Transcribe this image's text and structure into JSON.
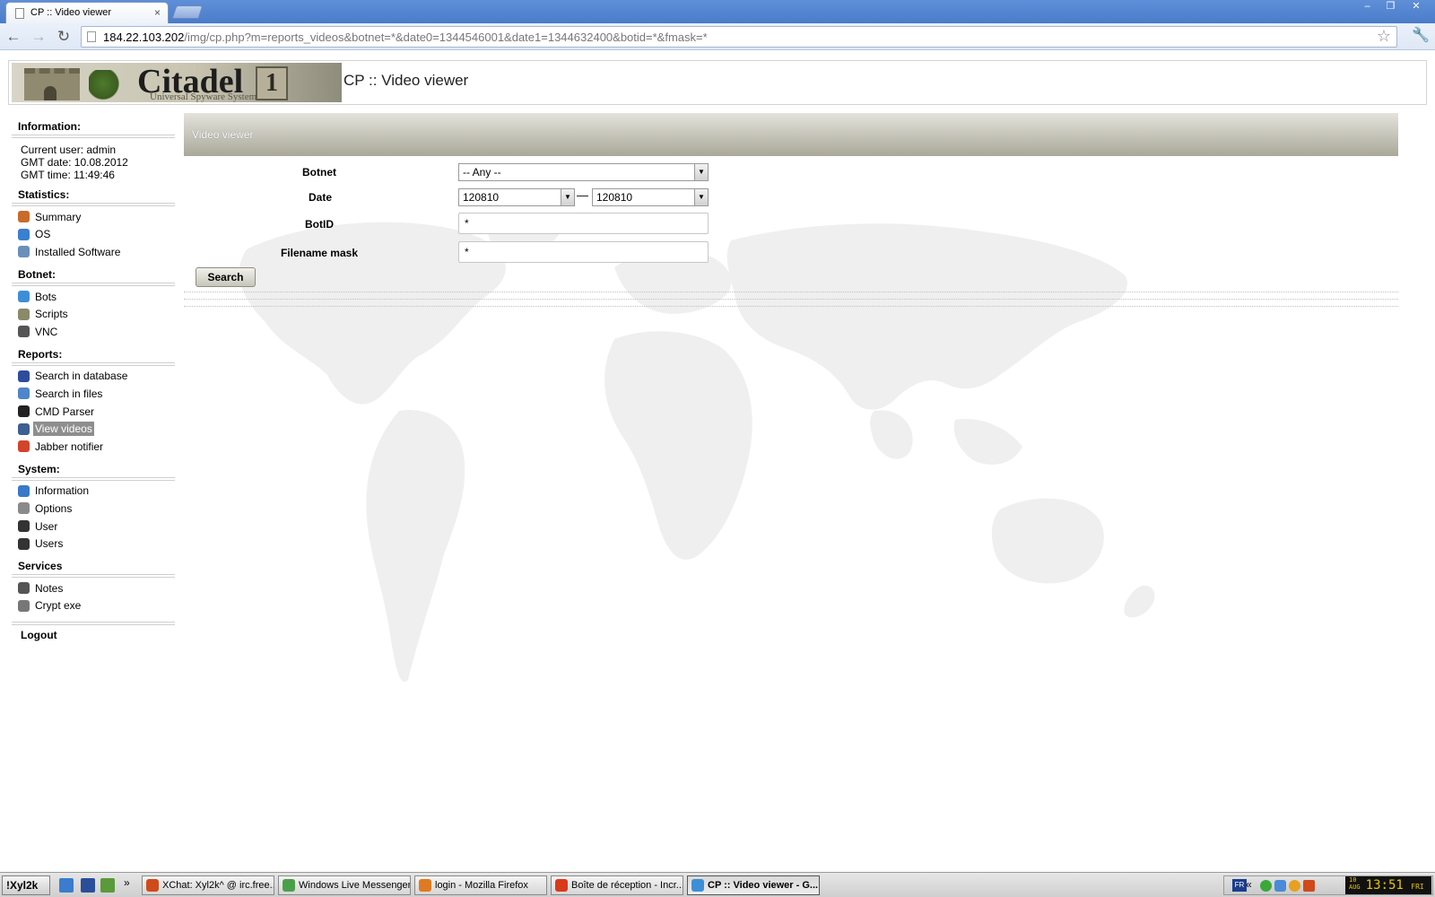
{
  "browser": {
    "tab_title": "CP :: Video viewer",
    "tab_close": "×",
    "url_host": "184.22.103.202",
    "url_path": "/img/cp.php?m=reports_videos&botnet=*&date0=1344546001&date1=1344632400&botid=*&fmask=*",
    "window_buttons": [
      "–",
      "❐",
      "✕"
    ]
  },
  "header": {
    "logo_word": "Citadel",
    "logo_badge": "1",
    "logo_sub": "Universal Spyware System",
    "title": "CP :: Video viewer"
  },
  "sidebar": {
    "info_title": "Information:",
    "info_lines": [
      "Current user: admin",
      "GMT date: 10.08.2012",
      "GMT time: 11:49:46"
    ],
    "sections": [
      {
        "title": "Statistics:",
        "items": [
          {
            "label": "Summary",
            "icon": "home-icon",
            "color": "#c86b2b"
          },
          {
            "label": "OS",
            "icon": "windows-icon",
            "color": "#3a7fd0"
          },
          {
            "label": "Installed Software",
            "icon": "software-icon",
            "color": "#6b8fb8"
          }
        ]
      },
      {
        "title": "Botnet:",
        "items": [
          {
            "label": "Bots",
            "icon": "globe-icon",
            "color": "#3c8fd6"
          },
          {
            "label": "Scripts",
            "icon": "clipboard-icon",
            "color": "#8a8a6a"
          },
          {
            "label": "VNC",
            "icon": "joystick-icon",
            "color": "#555555"
          }
        ]
      },
      {
        "title": "Reports:",
        "items": [
          {
            "label": "Search in database",
            "icon": "book-icon",
            "color": "#2d4c9c"
          },
          {
            "label": "Search in files",
            "icon": "folder-icon",
            "color": "#4f85c9"
          },
          {
            "label": "CMD Parser",
            "icon": "terminal-icon",
            "color": "#222222"
          },
          {
            "label": "View videos",
            "icon": "video-icon",
            "color": "#3d5f92",
            "active": true
          },
          {
            "label": "Jabber notifier",
            "icon": "jabber-icon",
            "color": "#d2452a"
          }
        ]
      },
      {
        "title": "System:",
        "items": [
          {
            "label": "Information",
            "icon": "info-icon",
            "color": "#3a78c8"
          },
          {
            "label": "Options",
            "icon": "gear-icon",
            "color": "#8a8a8a"
          },
          {
            "label": "User",
            "icon": "user-icon",
            "color": "#333333"
          },
          {
            "label": "Users",
            "icon": "users-icon",
            "color": "#333333"
          }
        ]
      },
      {
        "title": "Services",
        "items": [
          {
            "label": "Notes",
            "icon": "pen-icon",
            "color": "#555555"
          },
          {
            "label": "Crypt exe",
            "icon": "shield-icon",
            "color": "#777777"
          }
        ]
      }
    ],
    "logout": "Logout"
  },
  "panel": {
    "title": "Video viewer",
    "botnet_label": "Botnet",
    "botnet_value": "-- Any --",
    "date_label": "Date",
    "date_from": "120810",
    "date_sep": "—",
    "date_to": "120810",
    "botid_label": "BotID",
    "botid_value": "*",
    "fmask_label": "Filename mask",
    "fmask_value": "*",
    "search_label": "Search"
  },
  "taskbar": {
    "start": "!Xyl2k",
    "more": "»",
    "tasks": [
      {
        "label": "XChat: Xyl2k^ @ irc.free...",
        "color": "#d04a1a"
      },
      {
        "label": "Windows Live Messenger",
        "color": "#4aa04a"
      },
      {
        "label": "login - Mozilla Firefox",
        "color": "#e07a20"
      },
      {
        "label": "Boîte de réception - Incr...",
        "color": "#d83a1a"
      },
      {
        "label": "CP :: Video viewer - G...",
        "color": "#3c8fd6",
        "active": true
      }
    ],
    "lang": "FR",
    "tray_more": "«",
    "clock_day": "10",
    "clock_month": "AUG",
    "clock_time": "13:51",
    "clock_weekday": "FRI"
  }
}
